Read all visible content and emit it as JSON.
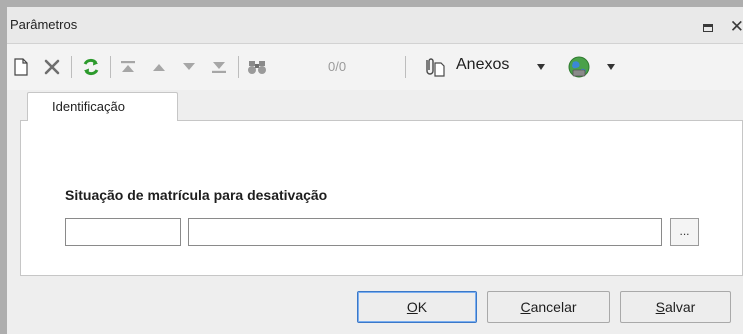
{
  "window": {
    "title": "Parâmetros"
  },
  "toolbar": {
    "record_counter": "0/0",
    "attachments_label": "Anexos"
  },
  "tabs": [
    {
      "label": "Identificação",
      "active": true
    }
  ],
  "form": {
    "field_label": "Situação de matrícula para desativação",
    "code_value": "",
    "description_value": "",
    "lookup_label": "..."
  },
  "buttons": {
    "ok": {
      "access_key": "O",
      "rest": "K"
    },
    "cancel": {
      "access_key": "C",
      "rest": "ancelar"
    },
    "save": {
      "access_key": "S",
      "rest": "alvar"
    }
  },
  "colors": {
    "accent": "#3b78c8",
    "refresh": "#2c9a2c",
    "chrome": "#aeaeae"
  }
}
